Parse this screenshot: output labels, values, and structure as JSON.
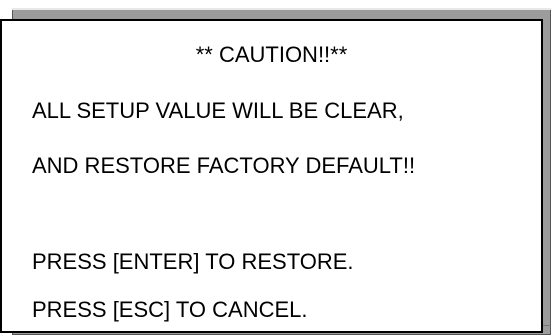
{
  "dialog": {
    "title": "** CAUTION!!**",
    "lines": [
      "ALL SETUP VALUE WILL BE CLEAR,",
      "AND RESTORE FACTORY DEFAULT!!",
      "PRESS [ENTER] TO RESTORE.",
      "PRESS [ESC] TO CANCEL."
    ]
  },
  "colors": {
    "backdrop": "#9c9c9c",
    "dialog_background": "#ffffff",
    "border": "#000000",
    "text": "#000000"
  }
}
